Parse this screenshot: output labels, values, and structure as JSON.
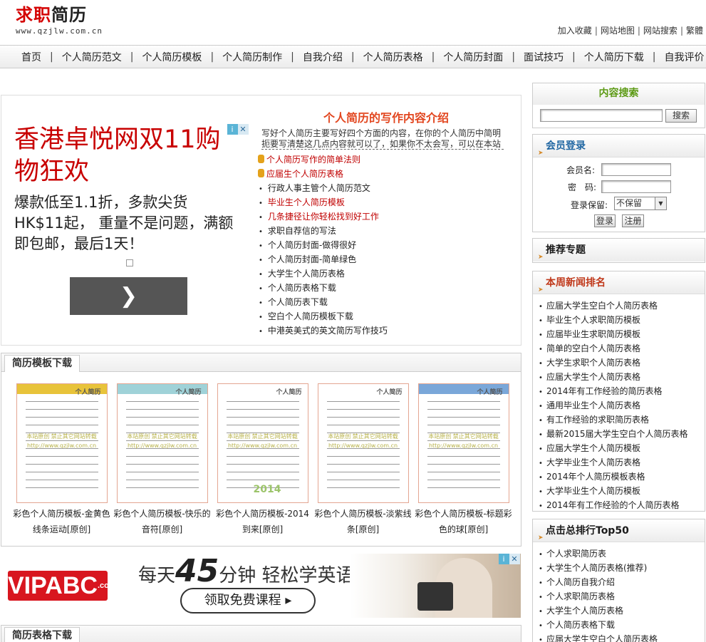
{
  "header": {
    "logo_title_red": "求职",
    "logo_title_dark": "简历",
    "logo_url": "www.qzjlw.com.cn",
    "top_links": [
      "加入收藏",
      "网站地图",
      "网站搜索",
      "繁體"
    ]
  },
  "nav": [
    "首页",
    "个人简历范文",
    "个人简历模板",
    "个人简历制作",
    "自我介绍",
    "个人简历表格",
    "个人简历封面",
    "面试技巧",
    "个人简历下载",
    "自我评价"
  ],
  "ad1": {
    "headline": "香港卓悦网双11购物狂欢",
    "body": "爆款低至1.1折，多款尖货HK$11起， 重量不是问题，满额即包邮，最后1天！",
    "button_icon": "chevron-right"
  },
  "intro": {
    "title": "个人简历的写作内容介绍",
    "text": "写好个人简历主要写好四个方面的内容，在你的个人简历中简明扼要写清楚这几点内容就可以了，如果你不太会写，可以在本站",
    "links": [
      {
        "label": "个人简历写作的简单法则",
        "style": "coin-red"
      },
      {
        "label": "应届生个人简历表格",
        "style": "coin-red"
      },
      {
        "label": "行政人事主管个人简历范文",
        "style": "plain"
      },
      {
        "label": "毕业生个人简历模板",
        "style": "red"
      },
      {
        "label": "几条捷径让你轻松找到好工作",
        "style": "red"
      },
      {
        "label": "求职自荐信的写法",
        "style": "plain"
      },
      {
        "label": "个人简历封面-做得很好",
        "style": "plain"
      },
      {
        "label": "个人简历封面-简单绿色",
        "style": "plain"
      },
      {
        "label": "大学生个人简历表格",
        "style": "plain"
      },
      {
        "label": "个人简历表格下载",
        "style": "plain"
      },
      {
        "label": "个人简历表下载",
        "style": "plain"
      },
      {
        "label": "空白个人简历模板下载",
        "style": "plain"
      },
      {
        "label": "中港英美式的英文简历写作技巧",
        "style": "plain"
      }
    ]
  },
  "templates_section": {
    "title": "简历模板下载",
    "items": [
      {
        "caption": "彩色个人简历模板-金黄色线条运动[原创]",
        "header_color": "#e8c33a"
      },
      {
        "caption": "彩色个人简历模板-快乐的音符[原创]",
        "header_color": "#9fd2d8"
      },
      {
        "caption": "彩色个人简历模板-2014到来[原创]",
        "header_color": "#ffffff"
      },
      {
        "caption": "彩色个人简历模板-淡紫线条[原创]",
        "header_color": "#ffffff"
      },
      {
        "caption": "彩色个人简历模板-标题彩色的球[原创]",
        "header_color": "#7aa7d9"
      }
    ],
    "thumb_texts": {
      "resume_title": "个人简历",
      "watermark": "本站原创 禁止其它网站转载",
      "site": "http://www.qzjlw.com.cn",
      "year": "2014"
    }
  },
  "ad2": {
    "brand": "VIPABC",
    "brand_suffix": ".com",
    "text_pre": "每天",
    "text_num": "45",
    "text_post": "分钟 轻松学英语",
    "button": "领取免费课程 ▸"
  },
  "table_section": {
    "title": "简历表格下载"
  },
  "sidebar": {
    "search": {
      "title": "内容搜索",
      "button": "搜索",
      "value": ""
    },
    "login": {
      "title": "会员登录",
      "username_label": "会员名:",
      "password_label": "密　码:",
      "keep_label": "登录保留:",
      "keep_value": "不保留",
      "login_button": "登录",
      "register_button": "注册"
    },
    "topics": {
      "title": "推荐专题"
    },
    "news": {
      "title": "本周新闻排名",
      "items": [
        "应届大学生空白个人简历表格",
        "毕业生个人求职简历模板",
        "应届毕业生求职简历模板",
        "简单的空白个人简历表格",
        "大学生求职个人简历表格",
        "应届大学生个人简历表格",
        "2014年有工作经验的简历表格",
        "通用毕业生个人简历表格",
        "有工作经验的求职简历表格",
        "最新2015届大学生空白个人简历表格",
        "应届大学生个人简历模板",
        "大学毕业生个人简历表格",
        "2014年个人简历模板表格",
        "大学毕业生个人简历模板",
        "2014年有工作经验的个人简历表格"
      ]
    },
    "top50": {
      "title": "点击总排行Top50",
      "items": [
        "个人求职简历表",
        "大学生个人简历表格(推荐)",
        "个人简历自我介绍",
        "个人求职简历表格",
        "大学生个人简历表格",
        "个人简历表格下载",
        "应届大学生空白个人简历表格"
      ]
    }
  },
  "colors": {
    "brand_red": "#d40000",
    "accent_orange": "#e2461f",
    "search_green": "#5c9a14",
    "login_blue": "#1f66a2"
  }
}
